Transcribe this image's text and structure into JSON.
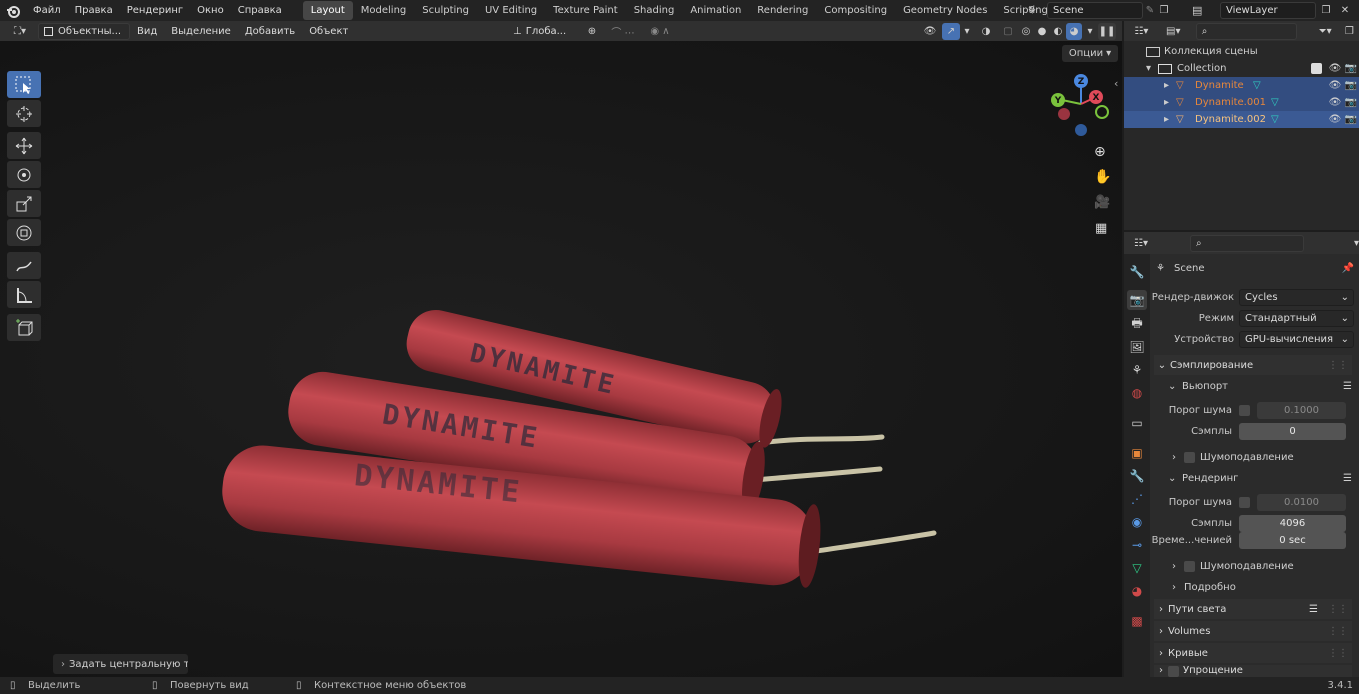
{
  "topbar": {
    "menus": [
      "Файл",
      "Правка",
      "Рендеринг",
      "Окно",
      "Справка"
    ],
    "workspaces": [
      "Layout",
      "Modeling",
      "Sculpting",
      "UV Editing",
      "Texture Paint",
      "Shading",
      "Animation",
      "Rendering",
      "Compositing",
      "Geometry Nodes",
      "Scripting"
    ],
    "active_workspace": "Layout",
    "add_tab": "+",
    "scene_name": "Scene",
    "view_layer": "ViewLayer"
  },
  "viewport_header": {
    "mode": "Объектны...",
    "menus": [
      "Вид",
      "Выделение",
      "Добавить",
      "Объект"
    ],
    "orientation": "Глоба...",
    "options": "Опции"
  },
  "viewport": {
    "last_operator": "Задать центральную точк",
    "navigation_gizmo": {
      "x": "X",
      "y": "Y",
      "z": "Z"
    },
    "label_text": "DYNAMITE"
  },
  "statusbar": {
    "select": "Выделить",
    "rotate": "Повернуть вид",
    "context": "Контекстное меню объектов",
    "version": "3.4.1"
  },
  "outliner": {
    "root": "Коллекция сцены",
    "collection": "Collection",
    "objects": [
      "Dynamite",
      "Dynamite.001",
      "Dynamite.002"
    ]
  },
  "properties": {
    "scene": "Scene",
    "render_engine_label": "Рендер-движок",
    "render_engine": "Cycles",
    "mode_label": "Режим",
    "mode": "Стандартный",
    "device_label": "Устройство",
    "device": "GPU-вычисления",
    "sampling": "Сэмплирование",
    "viewport": "Вьюпорт",
    "noise_threshold_label": "Порог шума",
    "viewport_noise_threshold": "0.1000",
    "samples_label": "Сэмплы",
    "viewport_samples": "0",
    "denoise": "Шумоподавление",
    "render": "Рендеринг",
    "render_noise_threshold": "0.0100",
    "render_samples": "4096",
    "time_limit_label": "Време...ченией",
    "time_limit": "0 sec",
    "advanced": "Подробно",
    "light_paths": "Пути света",
    "volumes": "Volumes",
    "curves": "Кривые",
    "simplify": "Упрощение"
  },
  "colors": {
    "accent": "#4772b3",
    "selected_object": "#e7873b",
    "dynamite_red": "#b4353e"
  }
}
